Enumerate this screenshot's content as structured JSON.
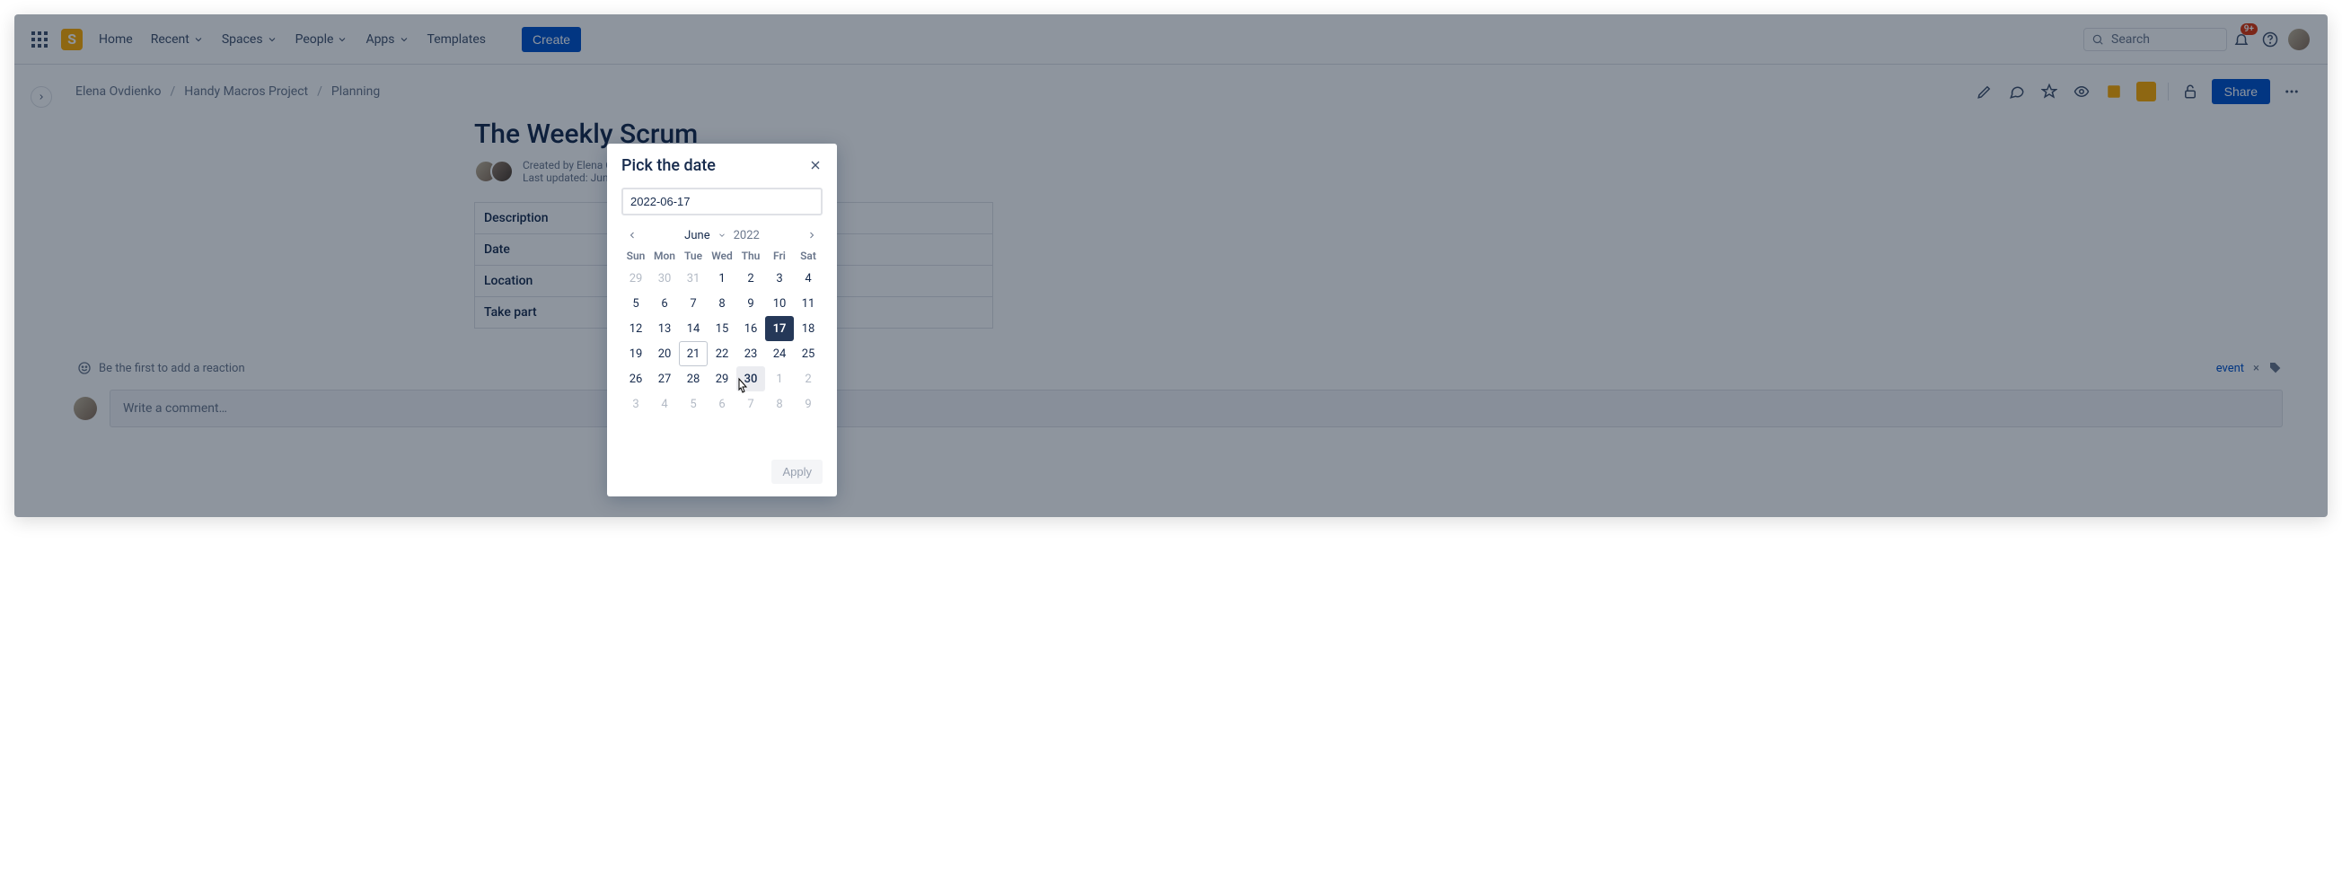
{
  "topnav": {
    "items": [
      "Home",
      "Recent",
      "Spaces",
      "People",
      "Apps",
      "Templates"
    ],
    "create": "Create",
    "search_placeholder": "Search",
    "badge": "9+"
  },
  "breadcrumb": [
    "Elena Ovdienko",
    "Handy Macros Project",
    "Planning"
  ],
  "page": {
    "title": "The Weekly Scrum",
    "created_by": "Created by Elena Ovdienko",
    "last_updated": "Last updated: Jun 14, 2022",
    "share": "Share"
  },
  "table_rows": [
    "Description",
    "Date",
    "Location",
    "Take part"
  ],
  "reactions": {
    "prompt": "Be the first to add a reaction",
    "tag": "event"
  },
  "comment_placeholder": "Write a comment…",
  "modal": {
    "title": "Pick the date",
    "input_value": "2022-06-17",
    "month": "June",
    "year": "2022",
    "dow": [
      "Sun",
      "Mon",
      "Tue",
      "Wed",
      "Thu",
      "Fri",
      "Sat"
    ],
    "days": [
      {
        "n": 29,
        "faded": true
      },
      {
        "n": 30,
        "faded": true
      },
      {
        "n": 31,
        "faded": true
      },
      {
        "n": 1
      },
      {
        "n": 2
      },
      {
        "n": 3
      },
      {
        "n": 4
      },
      {
        "n": 5
      },
      {
        "n": 6
      },
      {
        "n": 7
      },
      {
        "n": 8
      },
      {
        "n": 9
      },
      {
        "n": 10
      },
      {
        "n": 11
      },
      {
        "n": 12
      },
      {
        "n": 13
      },
      {
        "n": 14
      },
      {
        "n": 15
      },
      {
        "n": 16
      },
      {
        "n": 17,
        "selected": true
      },
      {
        "n": 18
      },
      {
        "n": 19
      },
      {
        "n": 20
      },
      {
        "n": 21,
        "today": true
      },
      {
        "n": 22
      },
      {
        "n": 23
      },
      {
        "n": 24
      },
      {
        "n": 25
      },
      {
        "n": 26
      },
      {
        "n": 27
      },
      {
        "n": 28
      },
      {
        "n": 29
      },
      {
        "n": 30,
        "hover": true
      },
      {
        "n": 1,
        "faded": true
      },
      {
        "n": 2,
        "faded": true
      },
      {
        "n": 3,
        "faded": true
      },
      {
        "n": 4,
        "faded": true
      },
      {
        "n": 5,
        "faded": true
      },
      {
        "n": 6,
        "faded": true
      },
      {
        "n": 7,
        "faded": true
      },
      {
        "n": 8,
        "faded": true
      },
      {
        "n": 9,
        "faded": true
      }
    ],
    "apply": "Apply"
  }
}
